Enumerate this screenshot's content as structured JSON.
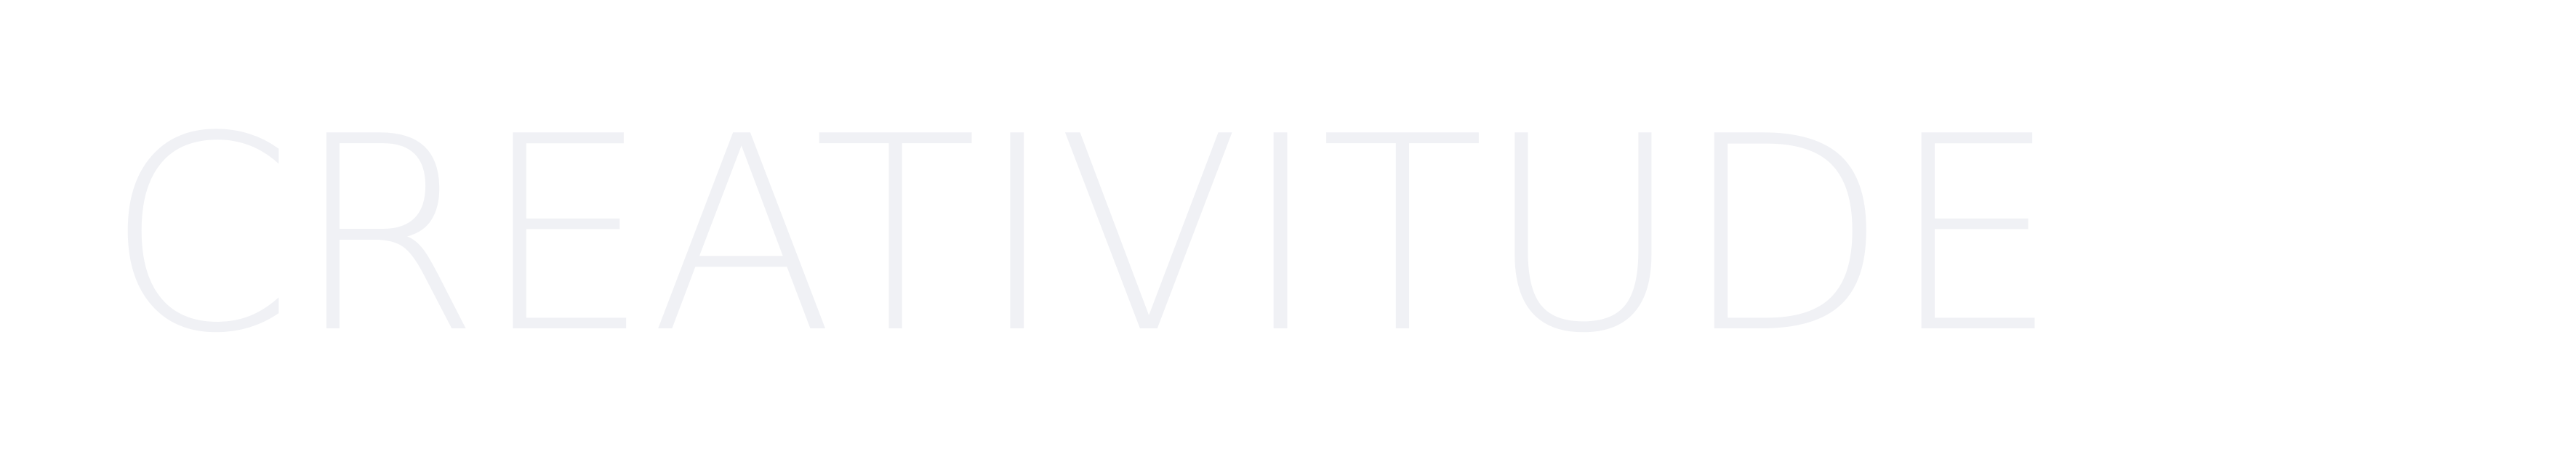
{
  "wordmark": {
    "text": "CREATIVITUDE",
    "color": "#f0f1f5"
  },
  "background": {
    "color": "#ffffff"
  }
}
